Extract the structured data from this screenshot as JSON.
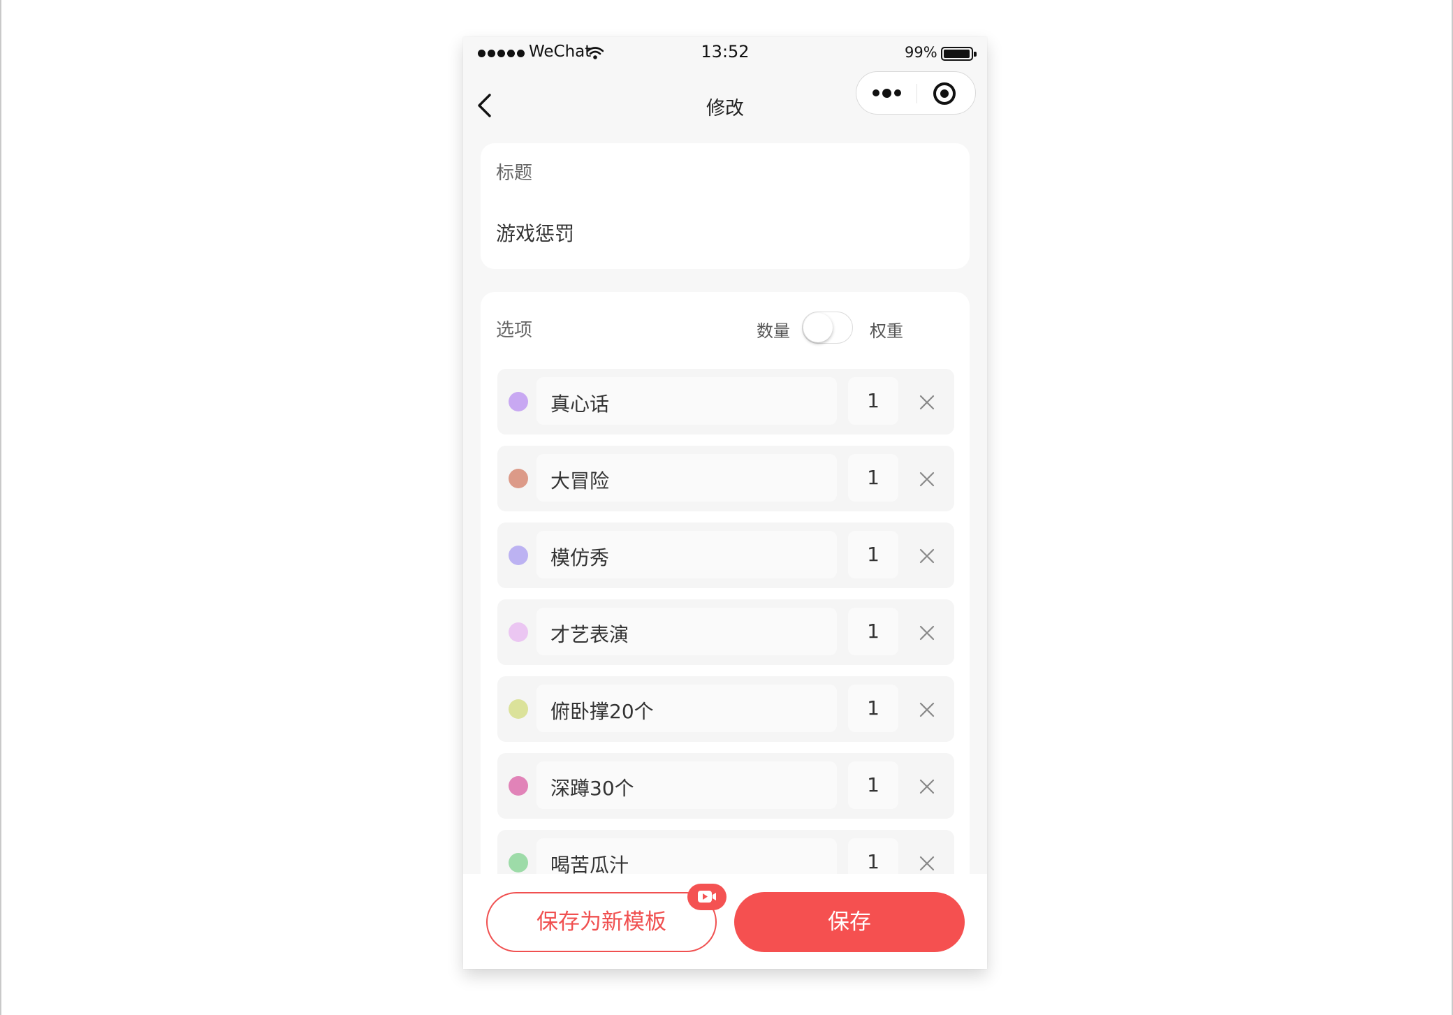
{
  "status_bar": {
    "carrier": "WeChat",
    "time": "13:52",
    "battery": "99%",
    "battery_level": 0.99
  },
  "nav": {
    "title": "修改",
    "back_icon": "chevron-left-icon",
    "more_icon": "more-dots-icon",
    "close_icon": "target-icon"
  },
  "title_section": {
    "label": "标题",
    "value": "游戏惩罚"
  },
  "options_section": {
    "label": "选项",
    "toggle_left": "数量",
    "toggle_right": "权重",
    "toggle_on": false,
    "items": [
      {
        "name": "真心话",
        "weight": "1",
        "color": "#c8a8f2"
      },
      {
        "name": "大冒险",
        "weight": "1",
        "color": "#dc9a88"
      },
      {
        "name": "模仿秀",
        "weight": "1",
        "color": "#bcb2f2"
      },
      {
        "name": "才艺表演",
        "weight": "1",
        "color": "#ebc6f2"
      },
      {
        "name": "俯卧撑20个",
        "weight": "1",
        "color": "#dbe29a"
      },
      {
        "name": "深蹲30个",
        "weight": "1",
        "color": "#e183b8"
      },
      {
        "name": "喝苦瓜汁",
        "weight": "1",
        "color": "#9ddba8"
      }
    ]
  },
  "footer": {
    "save_template_label": "保存为新模板",
    "save_label": "保存",
    "badge_icon": "video-icon",
    "accent": "#f55050"
  }
}
